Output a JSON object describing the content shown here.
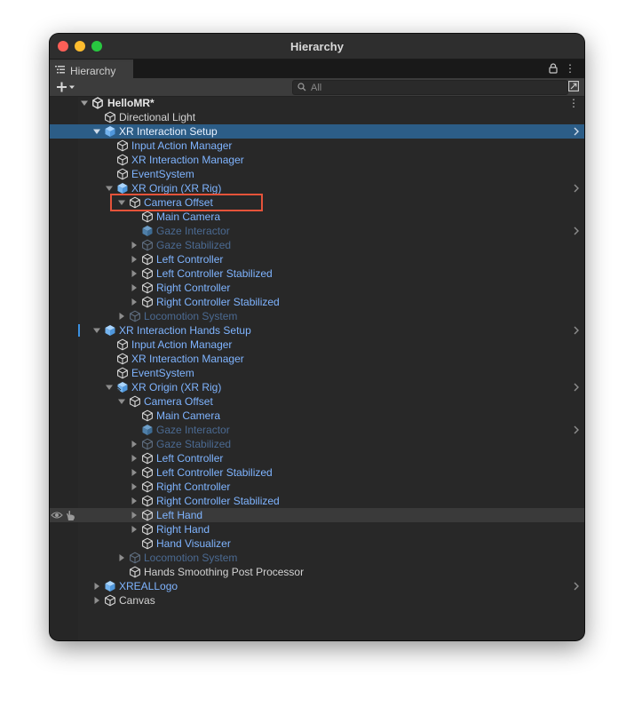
{
  "window": {
    "title": "Hierarchy"
  },
  "tab": {
    "label": "Hierarchy",
    "icon": "hierarchy-list-icon"
  },
  "toolbar": {
    "add_icon": "plus-dropdown-icon",
    "search_placeholder": "All",
    "search_value": ""
  },
  "scene": {
    "name": "HelloMR*",
    "icon": "unity-logo-icon"
  },
  "items": [
    {
      "label": "Directional Light",
      "depth": 1,
      "arrow": "none",
      "icon": "gameobject-cube-icon",
      "style": "white",
      "chevron": false
    },
    {
      "label": "XR Interaction Setup",
      "depth": 1,
      "arrow": "down",
      "icon": "prefab-cube-icon",
      "style": "selected",
      "chevron": true
    },
    {
      "label": "Input Action Manager",
      "depth": 2,
      "arrow": "none",
      "icon": "gameobject-cube-icon",
      "style": "prefab",
      "chevron": false
    },
    {
      "label": "XR Interaction Manager",
      "depth": 2,
      "arrow": "none",
      "icon": "gameobject-cube-icon",
      "style": "prefab",
      "chevron": false
    },
    {
      "label": "EventSystem",
      "depth": 2,
      "arrow": "none",
      "icon": "gameobject-cube-icon",
      "style": "prefab",
      "chevron": false
    },
    {
      "label": "XR Origin (XR Rig)",
      "depth": 2,
      "arrow": "down",
      "icon": "prefab-cube-icon",
      "style": "prefab",
      "chevron": true
    },
    {
      "label": "Camera Offset",
      "depth": 3,
      "arrow": "down",
      "icon": "gameobject-cube-icon",
      "style": "prefab",
      "chevron": false,
      "highlighted": true
    },
    {
      "label": "Main Camera",
      "depth": 4,
      "arrow": "none",
      "icon": "gameobject-cube-icon",
      "style": "prefab",
      "chevron": false
    },
    {
      "label": "Gaze Interactor",
      "depth": 4,
      "arrow": "none",
      "icon": "prefab-cube-icon",
      "style": "disabled",
      "chevron": true
    },
    {
      "label": "Gaze Stabilized",
      "depth": 4,
      "arrow": "right",
      "icon": "gameobject-cube-icon",
      "style": "disabled",
      "chevron": false
    },
    {
      "label": "Left Controller",
      "depth": 4,
      "arrow": "right",
      "icon": "gameobject-cube-icon",
      "style": "prefab",
      "chevron": false
    },
    {
      "label": "Left Controller Stabilized",
      "depth": 4,
      "arrow": "right",
      "icon": "gameobject-cube-icon",
      "style": "prefab",
      "chevron": false
    },
    {
      "label": "Right Controller",
      "depth": 4,
      "arrow": "right",
      "icon": "gameobject-cube-icon",
      "style": "prefab",
      "chevron": false
    },
    {
      "label": "Right Controller Stabilized",
      "depth": 4,
      "arrow": "right",
      "icon": "gameobject-cube-icon",
      "style": "prefab",
      "chevron": false
    },
    {
      "label": "Locomotion System",
      "depth": 3,
      "arrow": "right",
      "icon": "gameobject-cube-icon",
      "style": "disabled",
      "chevron": false
    },
    {
      "label": "XR Interaction Hands Setup",
      "depth": 1,
      "arrow": "down",
      "icon": "prefab-cube-icon",
      "style": "prefab",
      "chevron": true,
      "marker": true
    },
    {
      "label": "Input Action Manager",
      "depth": 2,
      "arrow": "none",
      "icon": "gameobject-cube-icon",
      "style": "prefab",
      "chevron": false
    },
    {
      "label": "XR Interaction Manager",
      "depth": 2,
      "arrow": "none",
      "icon": "gameobject-cube-icon",
      "style": "prefab",
      "chevron": false
    },
    {
      "label": "EventSystem",
      "depth": 2,
      "arrow": "none",
      "icon": "gameobject-cube-icon",
      "style": "prefab",
      "chevron": false
    },
    {
      "label": "XR Origin (XR Rig)",
      "depth": 2,
      "arrow": "down",
      "icon": "prefab-variant-cube-icon",
      "style": "prefab",
      "chevron": true
    },
    {
      "label": "Camera Offset",
      "depth": 3,
      "arrow": "down",
      "icon": "gameobject-cube-icon",
      "style": "prefab",
      "chevron": false
    },
    {
      "label": "Main Camera",
      "depth": 4,
      "arrow": "none",
      "icon": "gameobject-cube-icon",
      "style": "prefab",
      "chevron": false
    },
    {
      "label": "Gaze Interactor",
      "depth": 4,
      "arrow": "none",
      "icon": "prefab-cube-icon",
      "style": "disabled",
      "chevron": true
    },
    {
      "label": "Gaze Stabilized",
      "depth": 4,
      "arrow": "right",
      "icon": "gameobject-cube-icon",
      "style": "disabled",
      "chevron": false
    },
    {
      "label": "Left Controller",
      "depth": 4,
      "arrow": "right",
      "icon": "gameobject-cube-icon",
      "style": "prefab",
      "chevron": false
    },
    {
      "label": "Left Controller Stabilized",
      "depth": 4,
      "arrow": "right",
      "icon": "gameobject-cube-icon",
      "style": "prefab",
      "chevron": false
    },
    {
      "label": "Right Controller",
      "depth": 4,
      "arrow": "right",
      "icon": "gameobject-cube-icon",
      "style": "prefab",
      "chevron": false
    },
    {
      "label": "Right Controller Stabilized",
      "depth": 4,
      "arrow": "right",
      "icon": "gameobject-cube-icon",
      "style": "prefab",
      "chevron": false
    },
    {
      "label": "Left Hand",
      "depth": 4,
      "arrow": "right",
      "icon": "gameobject-cube-icon",
      "style": "prefab",
      "chevron": false,
      "hover": true
    },
    {
      "label": "Right Hand",
      "depth": 4,
      "arrow": "right",
      "icon": "gameobject-cube-icon",
      "style": "prefab",
      "chevron": false
    },
    {
      "label": "Hand Visualizer",
      "depth": 4,
      "arrow": "none",
      "icon": "gameobject-cube-icon",
      "style": "prefab",
      "chevron": false
    },
    {
      "label": "Locomotion System",
      "depth": 3,
      "arrow": "right",
      "icon": "gameobject-cube-icon",
      "style": "disabled",
      "chevron": false
    },
    {
      "label": "Hands Smoothing Post Processor",
      "depth": 3,
      "arrow": "none",
      "icon": "gameobject-cube-icon",
      "style": "white",
      "chevron": false
    },
    {
      "label": "XREALLogo",
      "depth": 1,
      "arrow": "right",
      "icon": "prefab-cube-icon",
      "style": "prefab",
      "chevron": true
    },
    {
      "label": "Canvas",
      "depth": 1,
      "arrow": "right",
      "icon": "gameobject-cube-icon",
      "style": "white",
      "chevron": false
    }
  ],
  "colors": {
    "selection": "#2c5d87",
    "prefab_text": "#7fb4ff",
    "disabled_text": "#4b6a92",
    "highlight_box": "#e5533a"
  }
}
